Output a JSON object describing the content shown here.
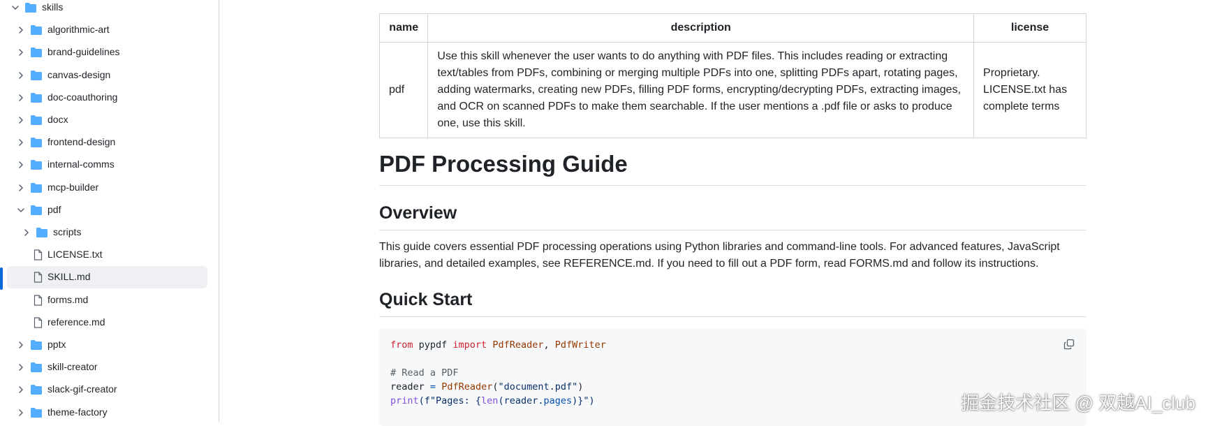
{
  "sidebar": {
    "items": [
      {
        "label": "skills",
        "type": "folder",
        "expanded": true,
        "depth": 0
      },
      {
        "label": "algorithmic-art",
        "type": "folder",
        "expanded": false,
        "depth": 1
      },
      {
        "label": "brand-guidelines",
        "type": "folder",
        "expanded": false,
        "depth": 1
      },
      {
        "label": "canvas-design",
        "type": "folder",
        "expanded": false,
        "depth": 1
      },
      {
        "label": "doc-coauthoring",
        "type": "folder",
        "expanded": false,
        "depth": 1
      },
      {
        "label": "docx",
        "type": "folder",
        "expanded": false,
        "depth": 1
      },
      {
        "label": "frontend-design",
        "type": "folder",
        "expanded": false,
        "depth": 1
      },
      {
        "label": "internal-comms",
        "type": "folder",
        "expanded": false,
        "depth": 1
      },
      {
        "label": "mcp-builder",
        "type": "folder",
        "expanded": false,
        "depth": 1
      },
      {
        "label": "pdf",
        "type": "folder",
        "expanded": true,
        "depth": 1
      },
      {
        "label": "scripts",
        "type": "folder",
        "expanded": false,
        "depth": 2
      },
      {
        "label": "LICENSE.txt",
        "type": "file",
        "depth": 2
      },
      {
        "label": "SKILL.md",
        "type": "file",
        "depth": 2,
        "selected": true
      },
      {
        "label": "forms.md",
        "type": "file",
        "depth": 2
      },
      {
        "label": "reference.md",
        "type": "file",
        "depth": 2
      },
      {
        "label": "pptx",
        "type": "folder",
        "expanded": false,
        "depth": 1
      },
      {
        "label": "skill-creator",
        "type": "folder",
        "expanded": false,
        "depth": 1
      },
      {
        "label": "slack-gif-creator",
        "type": "folder",
        "expanded": false,
        "depth": 1
      },
      {
        "label": "theme-factory",
        "type": "folder",
        "expanded": false,
        "depth": 1
      }
    ]
  },
  "table": {
    "headers": [
      "name",
      "description",
      "license"
    ],
    "row": {
      "name": "pdf",
      "description": "Use this skill whenever the user wants to do anything with PDF files. This includes reading or extracting text/tables from PDFs, combining or merging multiple PDFs into one, splitting PDFs apart, rotating pages, adding watermarks, creating new PDFs, filling PDF forms, encrypting/decrypting PDFs, extracting images, and OCR on scanned PDFs to make them searchable. If the user mentions a .pdf file or asks to produce one, use this skill.",
      "license": "Proprietary. LICENSE.txt has complete terms"
    }
  },
  "content": {
    "title": "PDF Processing Guide",
    "overview_heading": "Overview",
    "overview_text": "This guide covers essential PDF processing operations using Python libraries and command-line tools. For advanced features, JavaScript libraries, and detailed examples, see REFERENCE.md. If you need to fill out a PDF form, read FORMS.md and follow its instructions.",
    "quickstart_heading": "Quick Start"
  },
  "code": {
    "kw_from": "from",
    "mod_pypdf": " pypdf ",
    "kw_import": "import",
    "cls_reader": "PdfReader",
    "comma": ", ",
    "cls_writer": "PdfWriter",
    "comment": "# Read a PDF",
    "var_reader": "reader ",
    "op_eq": "=",
    "sp": " ",
    "cls_reader2": "PdfReader",
    "paren_open": "(",
    "str_doc": "\"document.pdf\"",
    "paren_close": ")",
    "fn_print": "print",
    "fstr_open": "(f\"Pages: {",
    "fn_len": "len",
    "reader_arg": "(reader.",
    "attr_pages": "pages",
    "fstr_close": ")}\")"
  },
  "watermark": "掘金技术社区 @ 双越AI_club",
  "colors": {
    "folder": "#54aeff",
    "accent": "#0969da",
    "border": "#d0d7de",
    "code_bg": "#f6f8fa"
  }
}
